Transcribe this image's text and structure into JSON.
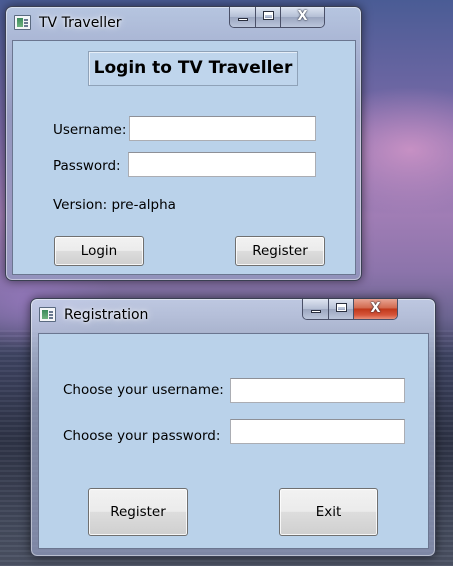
{
  "login_window": {
    "title": "TV Traveller",
    "heading": "Login to TV Traveller",
    "username_label": "Username:",
    "username_value": "",
    "password_label": "Password:",
    "password_value": "",
    "version_text": "Version: pre-alpha",
    "login_button": "Login",
    "register_button": "Register",
    "close_glyph": "X"
  },
  "registration_window": {
    "title": "Registration",
    "username_label": "Choose your username:",
    "username_value": "",
    "password_label": "Choose your password:",
    "password_value": "",
    "register_button": "Register",
    "exit_button": "Exit",
    "close_glyph": "X"
  },
  "icons": [
    "app-icon",
    "minimize-icon",
    "maximize-icon",
    "close-icon"
  ],
  "colors": {
    "client_background": "#bad2ea",
    "close_button_red": "#c0381a"
  }
}
